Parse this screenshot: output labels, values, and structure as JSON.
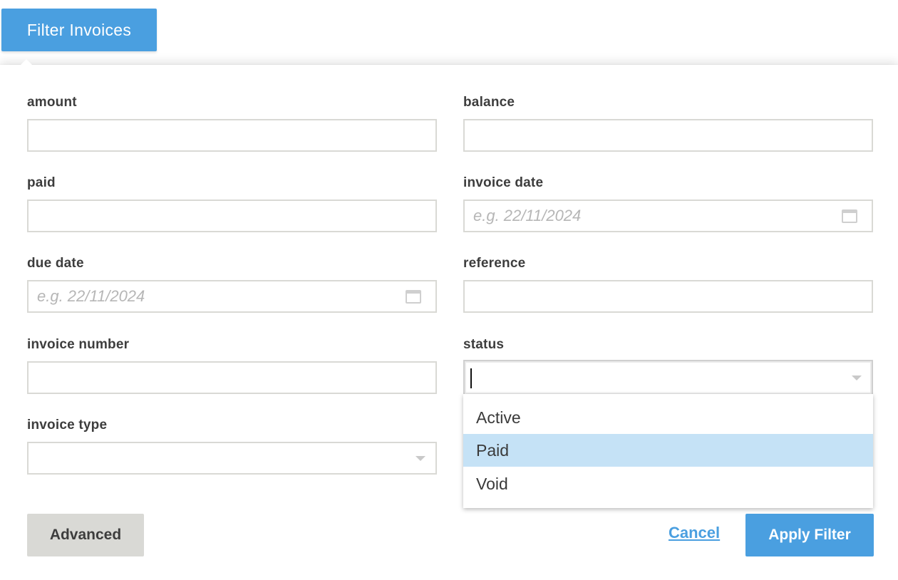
{
  "toggle": {
    "label": "Filter Invoices"
  },
  "fields": {
    "amount": {
      "label": "amount",
      "value": ""
    },
    "balance": {
      "label": "balance",
      "value": ""
    },
    "paid": {
      "label": "paid",
      "value": ""
    },
    "invoice_date": {
      "label": "invoice date",
      "value": "",
      "placeholder": "e.g. 22/11/2024"
    },
    "due_date": {
      "label": "due date",
      "value": "",
      "placeholder": "e.g. 22/11/2024"
    },
    "reference": {
      "label": "reference",
      "value": ""
    },
    "invoice_number": {
      "label": "invoice number",
      "value": ""
    },
    "status": {
      "label": "status",
      "value": ""
    },
    "invoice_type": {
      "label": "invoice type",
      "value": ""
    }
  },
  "status_dropdown": {
    "open": true,
    "highlighted": "Paid",
    "options": [
      "Active",
      "Paid",
      "Void"
    ]
  },
  "actions": {
    "advanced_label": "Advanced",
    "cancel_label": "Cancel",
    "apply_label": "Apply Filter"
  },
  "colors": {
    "accent": "#4a9fe0",
    "secondary_button": "#d9d9d5",
    "option_highlight": "#c5e2f6",
    "input_border": "#d9d9d5",
    "label_text": "#3d3d3d"
  },
  "icons": {
    "date_picker": "calendar-icon",
    "select_toggle": "chevron-down-icon"
  }
}
